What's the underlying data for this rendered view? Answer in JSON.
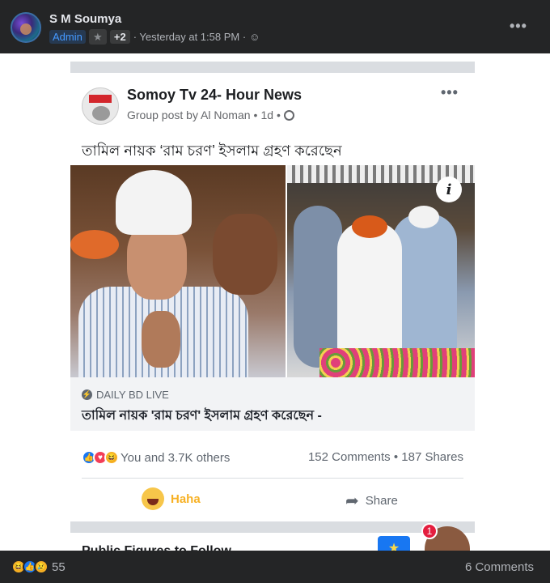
{
  "author": {
    "name": "S M Soumya",
    "badge": "Admin",
    "badge_more": "+2",
    "timestamp": "· Yesterday at 1:58 PM ·",
    "more": "•••"
  },
  "shared_post": {
    "page_name": "Somoy Tv 24- Hour News",
    "subtitle": "Group post by Al Noman",
    "age": "1d",
    "more": "•••",
    "text": "তামিল নায়ক ‘রাম চরণ’ ইসলাম গ্রহণ করেছেন",
    "info": "i",
    "link_source": "DAILY BD LIVE",
    "link_title": "তামিল নায়ক 'রাম চরণ' ইসলাম গ্রহণ করেছেন -",
    "reactions_text": "You and 3.7K others",
    "counts": "152 Comments • 187 Shares",
    "haha_label": "Haha",
    "share_label": "Share"
  },
  "next_section": {
    "title": "Public Figures to Follow",
    "notification_count": "1"
  },
  "footer": {
    "reaction_count": "55",
    "comments": "6 Comments"
  },
  "colors": {
    "background": "#242526",
    "accent": "#1877f2",
    "haha": "#f7b125"
  }
}
